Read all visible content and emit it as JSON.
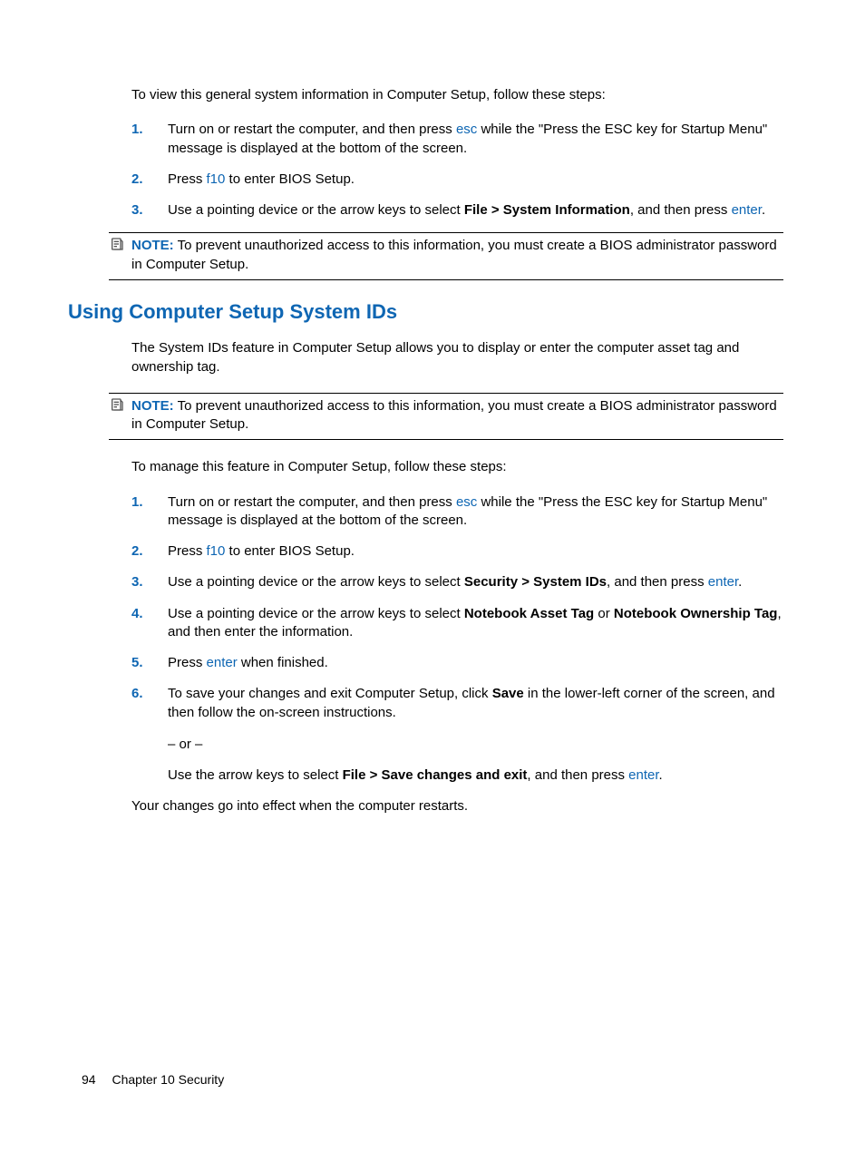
{
  "intro1": "To view this general system information in Computer Setup, follow these steps:",
  "list1": {
    "n1": "1.",
    "s1a": "Turn on or restart the computer, and then press ",
    "s1_esc": "esc",
    "s1b": " while the \"Press the ESC key for Startup Menu\" message is displayed at the bottom of the screen.",
    "n2": "2.",
    "s2a": "Press ",
    "s2_f10": "f10",
    "s2b": " to enter BIOS Setup.",
    "n3": "3.",
    "s3a": "Use a pointing device or the arrow keys to select ",
    "s3_bold": "File > System Information",
    "s3b": ", and then press ",
    "s3_enter": "enter",
    "s3c": "."
  },
  "note1": {
    "label": "NOTE:",
    "text": "To prevent unauthorized access to this information, you must create a BIOS administrator password in Computer Setup."
  },
  "heading": "Using Computer Setup System IDs",
  "intro2": "The System IDs feature in Computer Setup allows you to display or enter the computer asset tag and ownership tag.",
  "note2": {
    "label": "NOTE:",
    "text": "To prevent unauthorized access to this information, you must create a BIOS administrator password in Computer Setup."
  },
  "intro3": "To manage this feature in Computer Setup, follow these steps:",
  "list2": {
    "n1": "1.",
    "s1a": "Turn on or restart the computer, and then press ",
    "s1_esc": "esc",
    "s1b": " while the \"Press the ESC key for Startup Menu\" message is displayed at the bottom of the screen.",
    "n2": "2.",
    "s2a": "Press ",
    "s2_f10": "f10",
    "s2b": " to enter BIOS Setup.",
    "n3": "3.",
    "s3a": "Use a pointing device or the arrow keys to select ",
    "s3_bold": "Security > System IDs",
    "s3b": ", and then press ",
    "s3_enter": "enter",
    "s3c": ".",
    "n4": "4.",
    "s4a": "Use a pointing device or the arrow keys to select ",
    "s4_bold1": "Notebook Asset Tag",
    "s4b": " or ",
    "s4_bold2": "Notebook Ownership Tag",
    "s4c": ", and then enter the information.",
    "n5": "5.",
    "s5a": "Press ",
    "s5_enter": "enter",
    "s5b": " when finished.",
    "n6": "6.",
    "s6a": "To save your changes and exit Computer Setup, click ",
    "s6_bold": "Save",
    "s6b": " in the lower-left corner of the screen, and then follow the on-screen instructions.",
    "or": "– or –",
    "s6c": "Use the arrow keys to select ",
    "s6_bold2": "File > Save changes and exit",
    "s6d": ", and then press ",
    "s6_enter": "enter",
    "s6e": "."
  },
  "outro": "Your changes go into effect when the computer restarts.",
  "footer": {
    "page": "94",
    "chapter": "Chapter 10   Security"
  }
}
